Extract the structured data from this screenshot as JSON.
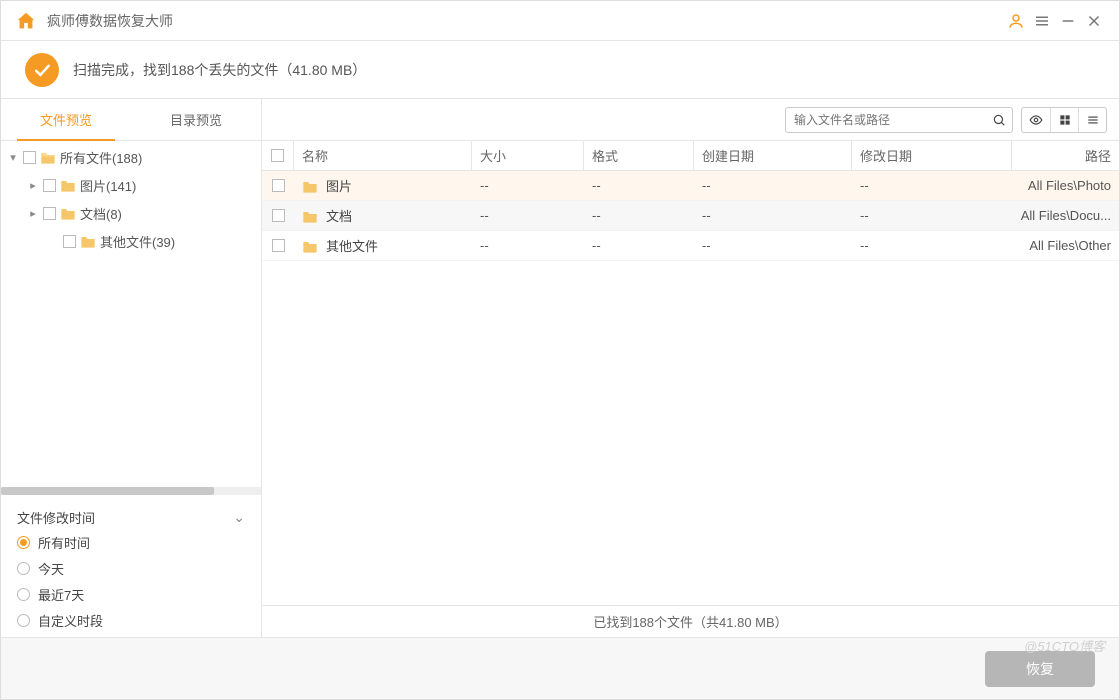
{
  "app": {
    "title": "疯师傅数据恢复大师"
  },
  "status": {
    "text": "扫描完成，找到188个丢失的文件（41.80 MB）"
  },
  "tabs": {
    "file_preview": "文件预览",
    "dir_preview": "目录预览"
  },
  "search": {
    "placeholder": "输入文件名或路径"
  },
  "tree": {
    "root": {
      "label": "所有文件(188)"
    },
    "photo": {
      "label": "图片(141)"
    },
    "doc": {
      "label": "文档(8)"
    },
    "other": {
      "label": "其他文件(39)"
    }
  },
  "filter": {
    "header": "文件修改时间",
    "opts": {
      "all": "所有时间",
      "today": "今天",
      "last7": "最近7天",
      "custom": "自定义时段"
    }
  },
  "columns": {
    "name": "名称",
    "size": "大小",
    "format": "格式",
    "cdate": "创建日期",
    "mdate": "修改日期",
    "path": "路径"
  },
  "rows": [
    {
      "name": "图片",
      "size": "--",
      "format": "--",
      "cdate": "--",
      "mdate": "--",
      "path": "All Files\\Photo"
    },
    {
      "name": "文档",
      "size": "--",
      "format": "--",
      "cdate": "--",
      "mdate": "--",
      "path": "All Files\\Docu..."
    },
    {
      "name": "其他文件",
      "size": "--",
      "format": "--",
      "cdate": "--",
      "mdate": "--",
      "path": "All Files\\Other"
    }
  ],
  "footer": {
    "summary": "已找到188个文件（共41.80 MB）"
  },
  "buttons": {
    "recover": "恢复"
  },
  "watermark": "@51CTO博客"
}
